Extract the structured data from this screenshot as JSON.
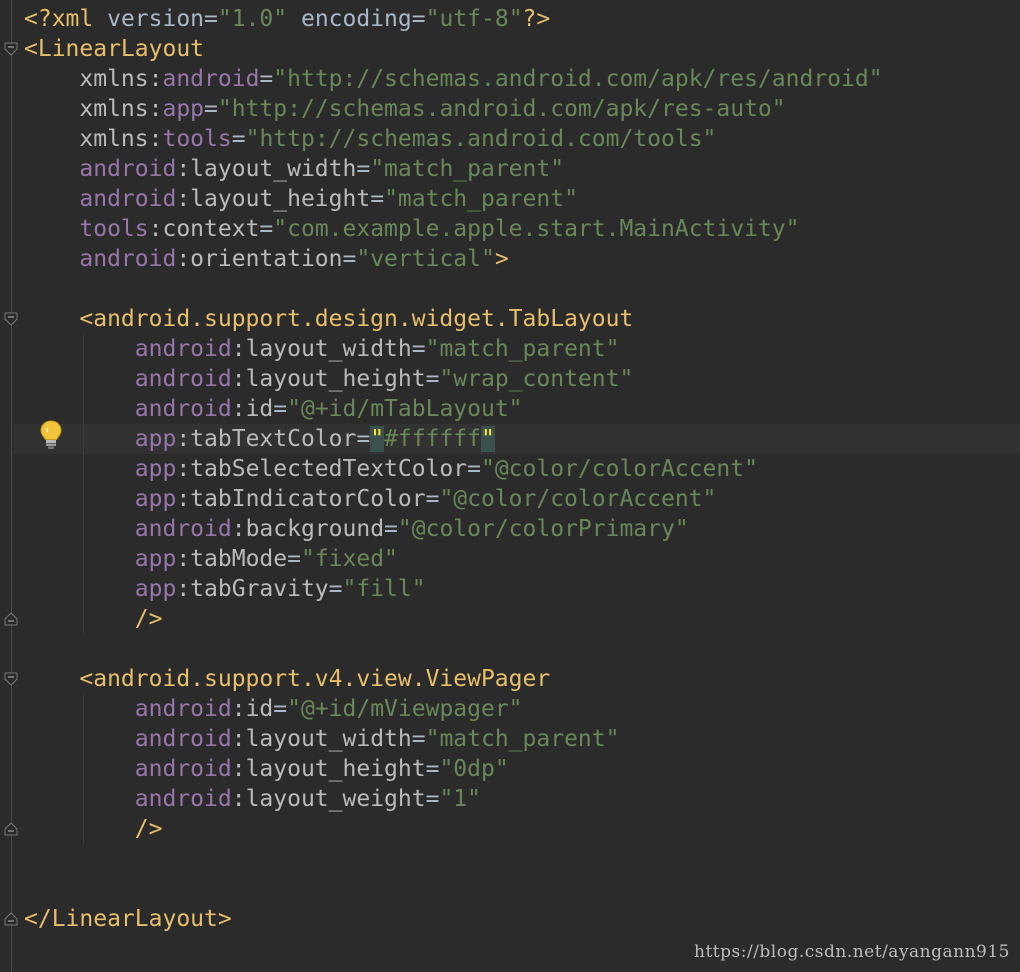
{
  "editor": {
    "language": "xml",
    "file_kind": "android-layout",
    "current_line_index": 14,
    "lines": [
      [
        {
          "k": "pi",
          "t": "<?xml "
        },
        {
          "k": "pl",
          "t": "version="
        },
        {
          "k": "v",
          "t": "\"1.0\""
        },
        {
          "k": "pl",
          "t": " encoding="
        },
        {
          "k": "v",
          "t": "\"utf-8\""
        },
        {
          "k": "pi",
          "t": "?>"
        }
      ],
      [
        {
          "k": "t",
          "t": "<LinearLayout"
        }
      ],
      [
        {
          "k": "pl",
          "t": "    "
        },
        {
          "k": "at",
          "t": "xmlns:"
        },
        {
          "k": "ns",
          "t": "android"
        },
        {
          "k": "pl",
          "t": "="
        },
        {
          "k": "v",
          "t": "\"http://schemas.android.com/apk/res/android\""
        }
      ],
      [
        {
          "k": "pl",
          "t": "    "
        },
        {
          "k": "at",
          "t": "xmlns:"
        },
        {
          "k": "ns",
          "t": "app"
        },
        {
          "k": "pl",
          "t": "="
        },
        {
          "k": "v",
          "t": "\"http://schemas.android.com/apk/res-auto\""
        }
      ],
      [
        {
          "k": "pl",
          "t": "    "
        },
        {
          "k": "at",
          "t": "xmlns:"
        },
        {
          "k": "ns",
          "t": "tools"
        },
        {
          "k": "pl",
          "t": "="
        },
        {
          "k": "v",
          "t": "\"http://schemas.android.com/tools\""
        }
      ],
      [
        {
          "k": "pl",
          "t": "    "
        },
        {
          "k": "ns",
          "t": "android"
        },
        {
          "k": "at",
          "t": ":layout_width"
        },
        {
          "k": "pl",
          "t": "="
        },
        {
          "k": "v",
          "t": "\"match_parent\""
        }
      ],
      [
        {
          "k": "pl",
          "t": "    "
        },
        {
          "k": "ns",
          "t": "android"
        },
        {
          "k": "at",
          "t": ":layout_height"
        },
        {
          "k": "pl",
          "t": "="
        },
        {
          "k": "v",
          "t": "\"match_parent\""
        }
      ],
      [
        {
          "k": "pl",
          "t": "    "
        },
        {
          "k": "ns",
          "t": "tools"
        },
        {
          "k": "at",
          "t": ":context"
        },
        {
          "k": "pl",
          "t": "="
        },
        {
          "k": "v",
          "t": "\"com.example.apple.start.MainActivity\""
        }
      ],
      [
        {
          "k": "pl",
          "t": "    "
        },
        {
          "k": "ns",
          "t": "android"
        },
        {
          "k": "at",
          "t": ":orientation"
        },
        {
          "k": "pl",
          "t": "="
        },
        {
          "k": "v",
          "t": "\"vertical\""
        },
        {
          "k": "t",
          "t": ">"
        }
      ],
      [],
      [
        {
          "k": "pl",
          "t": "    "
        },
        {
          "k": "t",
          "t": "<android.support.design.widget.TabLayout"
        }
      ],
      [
        {
          "k": "pl",
          "t": "        "
        },
        {
          "k": "ns",
          "t": "android"
        },
        {
          "k": "at",
          "t": ":layout_width"
        },
        {
          "k": "pl",
          "t": "="
        },
        {
          "k": "v",
          "t": "\"match_parent\""
        }
      ],
      [
        {
          "k": "pl",
          "t": "        "
        },
        {
          "k": "ns",
          "t": "android"
        },
        {
          "k": "at",
          "t": ":layout_height"
        },
        {
          "k": "pl",
          "t": "="
        },
        {
          "k": "v",
          "t": "\"wrap_content\""
        }
      ],
      [
        {
          "k": "pl",
          "t": "        "
        },
        {
          "k": "ns",
          "t": "android"
        },
        {
          "k": "at",
          "t": ":id"
        },
        {
          "k": "pl",
          "t": "="
        },
        {
          "k": "v",
          "t": "\"@+id/mTabLayout\""
        }
      ],
      [
        {
          "k": "pl",
          "t": "        "
        },
        {
          "k": "ns",
          "t": "app"
        },
        {
          "k": "at",
          "t": ":tabTextColor"
        },
        {
          "k": "pl",
          "t": "="
        },
        {
          "k": "caret",
          "t": ""
        },
        {
          "k": "bm",
          "t": "\""
        },
        {
          "k": "v",
          "t": "#ffffff"
        },
        {
          "k": "bm",
          "t": "\""
        }
      ],
      [
        {
          "k": "pl",
          "t": "        "
        },
        {
          "k": "ns",
          "t": "app"
        },
        {
          "k": "at",
          "t": ":tabSelectedTextColor"
        },
        {
          "k": "pl",
          "t": "="
        },
        {
          "k": "v",
          "t": "\"@color/colorAccent\""
        }
      ],
      [
        {
          "k": "pl",
          "t": "        "
        },
        {
          "k": "ns",
          "t": "app"
        },
        {
          "k": "at",
          "t": ":tabIndicatorColor"
        },
        {
          "k": "pl",
          "t": "="
        },
        {
          "k": "v",
          "t": "\"@color/colorAccent\""
        }
      ],
      [
        {
          "k": "pl",
          "t": "        "
        },
        {
          "k": "ns",
          "t": "android"
        },
        {
          "k": "at",
          "t": ":background"
        },
        {
          "k": "pl",
          "t": "="
        },
        {
          "k": "v",
          "t": "\"@color/colorPrimary\""
        }
      ],
      [
        {
          "k": "pl",
          "t": "        "
        },
        {
          "k": "ns",
          "t": "app"
        },
        {
          "k": "at",
          "t": ":tabMode"
        },
        {
          "k": "pl",
          "t": "="
        },
        {
          "k": "v",
          "t": "\"fixed\""
        }
      ],
      [
        {
          "k": "pl",
          "t": "        "
        },
        {
          "k": "ns",
          "t": "app"
        },
        {
          "k": "at",
          "t": ":tabGravity"
        },
        {
          "k": "pl",
          "t": "="
        },
        {
          "k": "v",
          "t": "\"fill\""
        }
      ],
      [
        {
          "k": "pl",
          "t": "        "
        },
        {
          "k": "t",
          "t": "/>"
        }
      ],
      [],
      [
        {
          "k": "pl",
          "t": "    "
        },
        {
          "k": "t",
          "t": "<android.support.v4.view.ViewPager"
        }
      ],
      [
        {
          "k": "pl",
          "t": "        "
        },
        {
          "k": "ns",
          "t": "android"
        },
        {
          "k": "at",
          "t": ":id"
        },
        {
          "k": "pl",
          "t": "="
        },
        {
          "k": "v",
          "t": "\"@+id/mViewpager\""
        }
      ],
      [
        {
          "k": "pl",
          "t": "        "
        },
        {
          "k": "ns",
          "t": "android"
        },
        {
          "k": "at",
          "t": ":layout_width"
        },
        {
          "k": "pl",
          "t": "="
        },
        {
          "k": "v",
          "t": "\"match_parent\""
        }
      ],
      [
        {
          "k": "pl",
          "t": "        "
        },
        {
          "k": "ns",
          "t": "android"
        },
        {
          "k": "at",
          "t": ":layout_height"
        },
        {
          "k": "pl",
          "t": "="
        },
        {
          "k": "v",
          "t": "\"0dp\""
        }
      ],
      [
        {
          "k": "pl",
          "t": "        "
        },
        {
          "k": "ns",
          "t": "android"
        },
        {
          "k": "at",
          "t": ":layout_weight"
        },
        {
          "k": "pl",
          "t": "="
        },
        {
          "k": "v",
          "t": "\"1\""
        }
      ],
      [
        {
          "k": "pl",
          "t": "        "
        },
        {
          "k": "t",
          "t": "/>"
        }
      ],
      [],
      [],
      [
        {
          "k": "t",
          "t": "</LinearLayout>"
        }
      ]
    ],
    "fold_markers": [
      {
        "line": 1,
        "kind": "open"
      },
      {
        "line": 10,
        "kind": "open"
      },
      {
        "line": 20,
        "kind": "close"
      },
      {
        "line": 22,
        "kind": "open"
      },
      {
        "line": 27,
        "kind": "close"
      },
      {
        "line": 30,
        "kind": "close"
      }
    ],
    "intention_icon": "lightbulb-icon"
  },
  "colors": {
    "background": "#2b2b2b",
    "current_line": "#323232",
    "tag": "#e8bf6a",
    "namespace": "#9876aa",
    "attribute": "#bababa",
    "string": "#6a8759",
    "plain": "#a9b7c6",
    "brace_match_bg": "#3b514d",
    "brace_match_fg": "#ffef28"
  },
  "watermark": "https://blog.csdn.net/ayangann915"
}
